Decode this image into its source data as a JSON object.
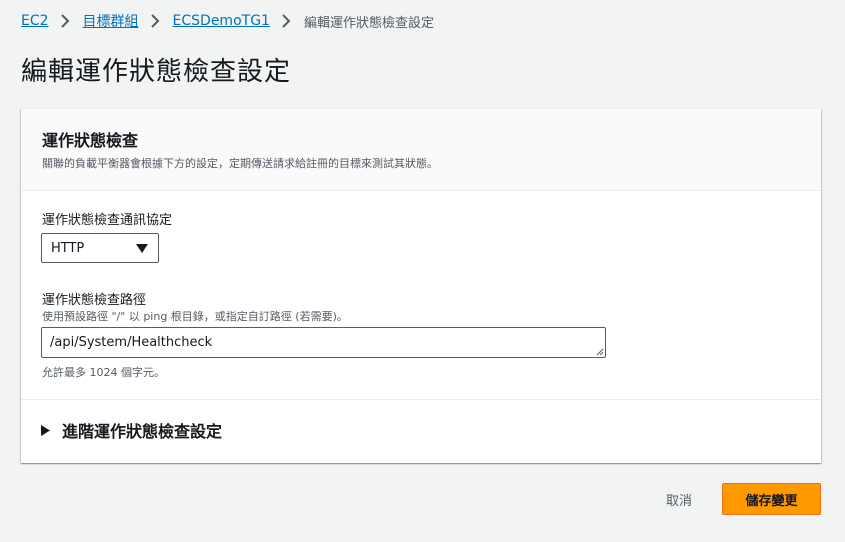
{
  "breadcrumb": {
    "items": [
      "EC2",
      "目標群組",
      "ECSDemoTG1"
    ],
    "current": "編輯運作狀態檢查設定"
  },
  "page": {
    "title": "編輯運作狀態檢查設定"
  },
  "panel": {
    "title": "運作狀態檢查",
    "description": "關聯的負載平衡器會根據下方的設定，定期傳送請求給註冊的目標來測試其狀態。",
    "protocol": {
      "label": "運作狀態檢查通訊協定",
      "value": "HTTP"
    },
    "path": {
      "label": "運作狀態檢查路徑",
      "description": "使用預設路徑 \"/\" 以 ping 根目錄，或指定自訂路徑 (若需要)。",
      "value": "/api/System/Healthcheck",
      "constraint": "允許最多 1024 個字元。"
    },
    "advanced": {
      "label": "進階運作狀態檢查設定"
    }
  },
  "actions": {
    "cancel": "取消",
    "save": "儲存變更"
  },
  "colors": {
    "link": "#0073bb",
    "primary_button": "#ff9900",
    "background": "#f2f3f3"
  },
  "icons": [
    "chevron-right-icon",
    "caret-down-icon",
    "caret-right-icon",
    "resize-handle-icon"
  ]
}
